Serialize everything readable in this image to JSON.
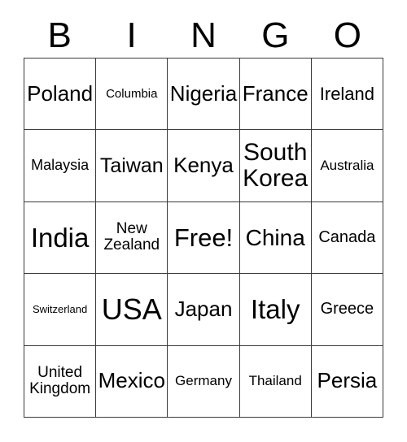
{
  "card": {
    "title_letters": [
      "B",
      "I",
      "N",
      "G",
      "O"
    ],
    "colors": {
      "background": "#ffffff",
      "grid_line": "#3a3a3a",
      "text": "#000000"
    },
    "rows": [
      [
        {
          "label": "Poland",
          "size": "fs-xxl"
        },
        {
          "label": "Columbia",
          "size": "fs-xs"
        },
        {
          "label": "Nigeria",
          "size": "fs-xxl"
        },
        {
          "label": "France",
          "size": "fs-xxl"
        },
        {
          "label": "Ireland",
          "size": "fs-l"
        }
      ],
      [
        {
          "label": "Malaysia",
          "size": "fs-sm"
        },
        {
          "label": "Taiwan",
          "size": "fs-xl"
        },
        {
          "label": "Kenya",
          "size": "fs-xxl"
        },
        {
          "label": "South\nKorea",
          "size": "fs-h2"
        },
        {
          "label": "Australia",
          "size": "fs-s"
        }
      ],
      [
        {
          "label": "India",
          "size": "fs-h4"
        },
        {
          "label": "New\nZealand",
          "size": "fs-m"
        },
        {
          "label": "Free!",
          "size": "fs-h3"
        },
        {
          "label": "China",
          "size": "fs-h1"
        },
        {
          "label": "Canada",
          "size": "fs-ml"
        }
      ],
      [
        {
          "label": "Switzerland",
          "size": "fs-xxs"
        },
        {
          "label": "USA",
          "size": "fs-h5"
        },
        {
          "label": "Japan",
          "size": "fs-xxl"
        },
        {
          "label": "Italy",
          "size": "fs-h4"
        },
        {
          "label": "Greece",
          "size": "fs-ml"
        }
      ],
      [
        {
          "label": "United\nKingdom",
          "size": "fs-m"
        },
        {
          "label": "Mexico",
          "size": "fs-xxl"
        },
        {
          "label": "Germany",
          "size": "fs-s"
        },
        {
          "label": "Thailand",
          "size": "fs-s"
        },
        {
          "label": "Persia",
          "size": "fs-xxl"
        }
      ]
    ]
  }
}
